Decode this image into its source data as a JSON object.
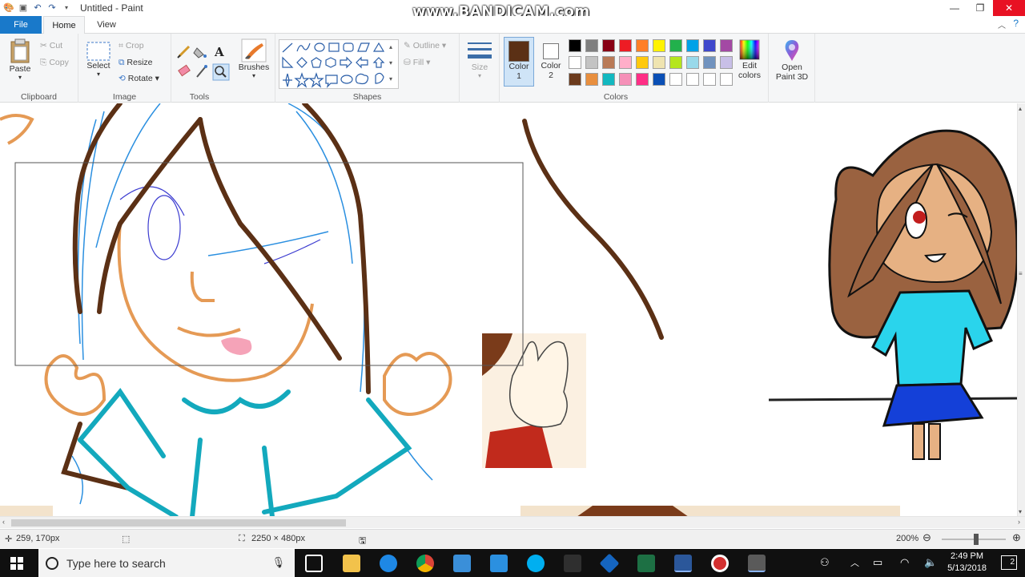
{
  "window": {
    "title": "Untitled - Paint",
    "watermark": "www.BANDICAM.com",
    "minimize": "—",
    "maximize": "❐",
    "close": "✕"
  },
  "tabs": {
    "file": "File",
    "home": "Home",
    "view": "View"
  },
  "clipboard": {
    "paste": "Paste",
    "cut": "Cut",
    "copy": "Copy",
    "label": "Clipboard"
  },
  "image": {
    "select": "Select",
    "crop": "Crop",
    "resize": "Resize",
    "rotate": "Rotate",
    "label": "Image"
  },
  "tools": {
    "label": "Tools",
    "brushes": "Brushes"
  },
  "shapes": {
    "outline": "Outline",
    "fill": "Fill",
    "label": "Shapes"
  },
  "size": {
    "label": "Size"
  },
  "colors": {
    "color1_label": "Color",
    "color1_num": "1",
    "color2_label": "Color",
    "color2_num": "2",
    "label": "Colors",
    "edit": "Edit colors",
    "paint3d": "Open Paint 3D",
    "color1": "#5b3015",
    "color2": "#ffffff",
    "palette_row1": [
      "#000000",
      "#7f7f7f",
      "#880015",
      "#ed1c24",
      "#ff7f27",
      "#fff200",
      "#22b14c",
      "#00a2e8",
      "#3f48cc",
      "#a349a4"
    ],
    "palette_row2": [
      "#ffffff",
      "#c3c3c3",
      "#b97a57",
      "#ffaec9",
      "#ffc90e",
      "#efe4b0",
      "#b5e61d",
      "#99d9ea",
      "#7092be",
      "#c8bfe7"
    ],
    "palette_row3": [
      "#6b3a1c",
      "#e88f3f",
      "#12b8c0",
      "#f590b8",
      "#ff2e86",
      "#0a4fb5",
      "#ffffff",
      "#ffffff",
      "#ffffff",
      "#ffffff"
    ]
  },
  "status": {
    "cursor_pos": "259, 170px",
    "image_size": "2250 × 480px",
    "zoom": "200%"
  },
  "taskbar": {
    "search_placeholder": "Type here to search",
    "time": "2:49 PM",
    "date": "5/13/2018",
    "notifications": "2"
  }
}
